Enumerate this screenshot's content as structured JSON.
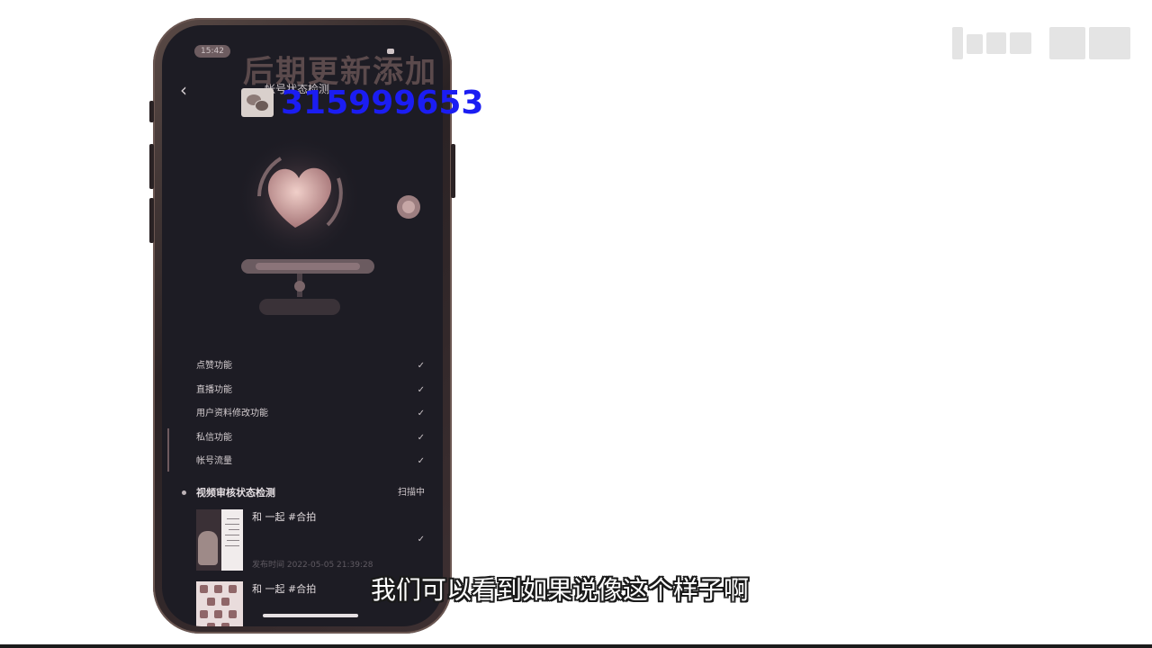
{
  "overlay": {
    "title": "后期更新添加",
    "number": "315999653",
    "subtitle": "我们可以看到如果说像这个样子啊"
  },
  "phone": {
    "status_time": "15:42",
    "header": {
      "back_icon": "chevron-left-icon",
      "title": "帐号状态检测"
    },
    "checklist": [
      {
        "label": "点赞功能",
        "status": "✓"
      },
      {
        "label": "直播功能",
        "status": "✓"
      },
      {
        "label": "用户资料修改功能",
        "status": "✓"
      },
      {
        "label": "私信功能",
        "status": "✓"
      },
      {
        "label": "帐号流量",
        "status": "✓"
      }
    ],
    "video_section": {
      "title": "视频审核状态检测",
      "status": "扫描中"
    },
    "videos": [
      {
        "title": "和 一起 #合拍",
        "time": "发布时间 2022-05-05 21:39:28",
        "status": "✓"
      },
      {
        "title": "和 一起 #合拍"
      }
    ]
  },
  "colors": {
    "screen_bg": "#1d1c24",
    "number_blue": "#1b1df2",
    "heart_pink": "#e0b9b6"
  }
}
